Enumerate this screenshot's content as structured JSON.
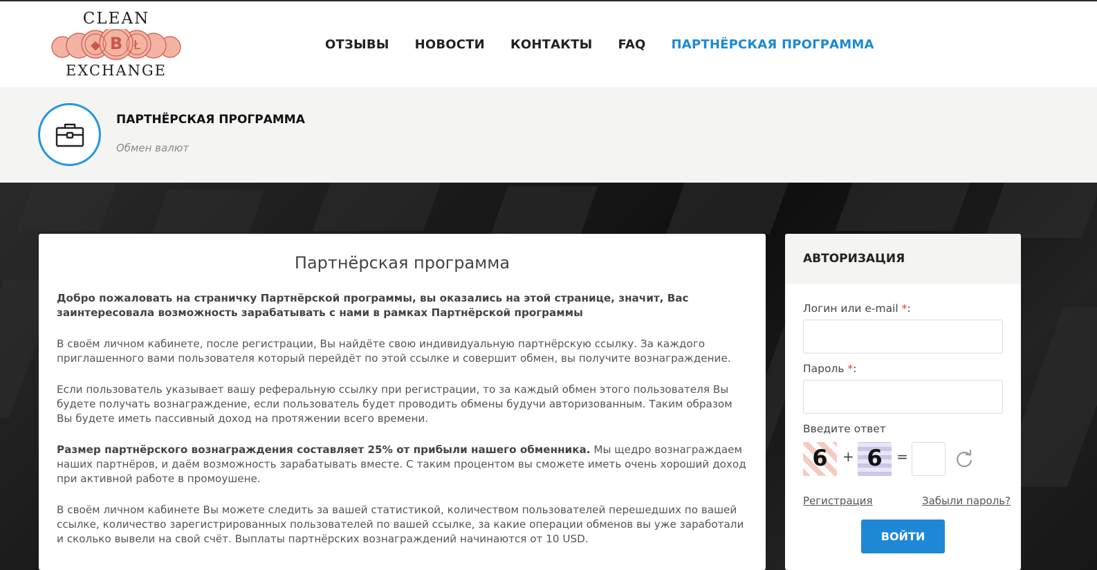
{
  "logo": {
    "top_text": "CLEAN",
    "bottom_text": "EXCHANGE"
  },
  "nav": {
    "items": [
      {
        "label": "ОТЗЫВЫ",
        "active": false
      },
      {
        "label": "НОВОСТИ",
        "active": false
      },
      {
        "label": "КОНТАКТЫ",
        "active": false
      },
      {
        "label": "FAQ",
        "active": false
      },
      {
        "label": "ПАРТНЁРСКАЯ ПРОГРАММА",
        "active": true
      }
    ]
  },
  "page_header": {
    "icon": "briefcase-icon",
    "title": "ПАРТНЁРСКАЯ ПРОГРАММА",
    "subtitle": "Обмен валют"
  },
  "content": {
    "title": "Партнёрская программа",
    "lead": "Добро пожаловать на страничку Партнёрской программы, вы оказались на этой странице, значит, Вас заинтересовала возможность зарабатывать с нами в рамках Партнёрской программы",
    "p1": "В своём личном кабинете, после регистрации, Вы найдёте свою индивидуальную партнёрскую ссылку. За каждого приглашенного вами пользователя который перейдёт по этой ссылке и совершит обмен, вы получите вознаграждение.",
    "p2": "Если пользователь указывает вашу реферальную ссылку при регистрации, то за каждый обмен этого пользователя Вы будете получать вознаграждение, если пользователь будет проводить обмены будучи авторизованным. Таким образом Вы будете иметь пассивный доход на протяжении всего времени.",
    "p3_bold": "Размер партнёрского вознаграждения составляет 25% от прибыли нашего обменника.",
    "p3_rest": " Мы щедро вознаграждаем наших партнёров, и даём возможность зарабатывать вместе. С таким процентом вы сможете иметь очень хороший доход при активной работе в промоушене.",
    "p4": "В своём личном кабинете Вы можете следить за вашей статистикой, количеством пользователей перешедших по вашей ссылке, количество зарегистрированных пользователей по вашей ссылке, за какие операции обменов вы уже заработали и сколько вывели на свой счёт. Выплаты партнёрских вознаграждений начинаются от 10 USD."
  },
  "auth": {
    "title": "АВТОРИЗАЦИЯ",
    "login_label": "Логин или e-mail ",
    "password_label": "Пароль ",
    "required_mark": "*",
    "login_value": "",
    "password_value": "",
    "captcha_label": "Введите ответ",
    "captcha_a": "6",
    "captcha_op": "+",
    "captcha_b": "6",
    "captcha_eq": "=",
    "captcha_answer": "",
    "register_link": "Регистрация",
    "forgot_link": "Забыли пароль?",
    "submit_label": "ВОЙТИ"
  },
  "colors": {
    "accent": "#1e88d6",
    "required": "#e53935"
  }
}
